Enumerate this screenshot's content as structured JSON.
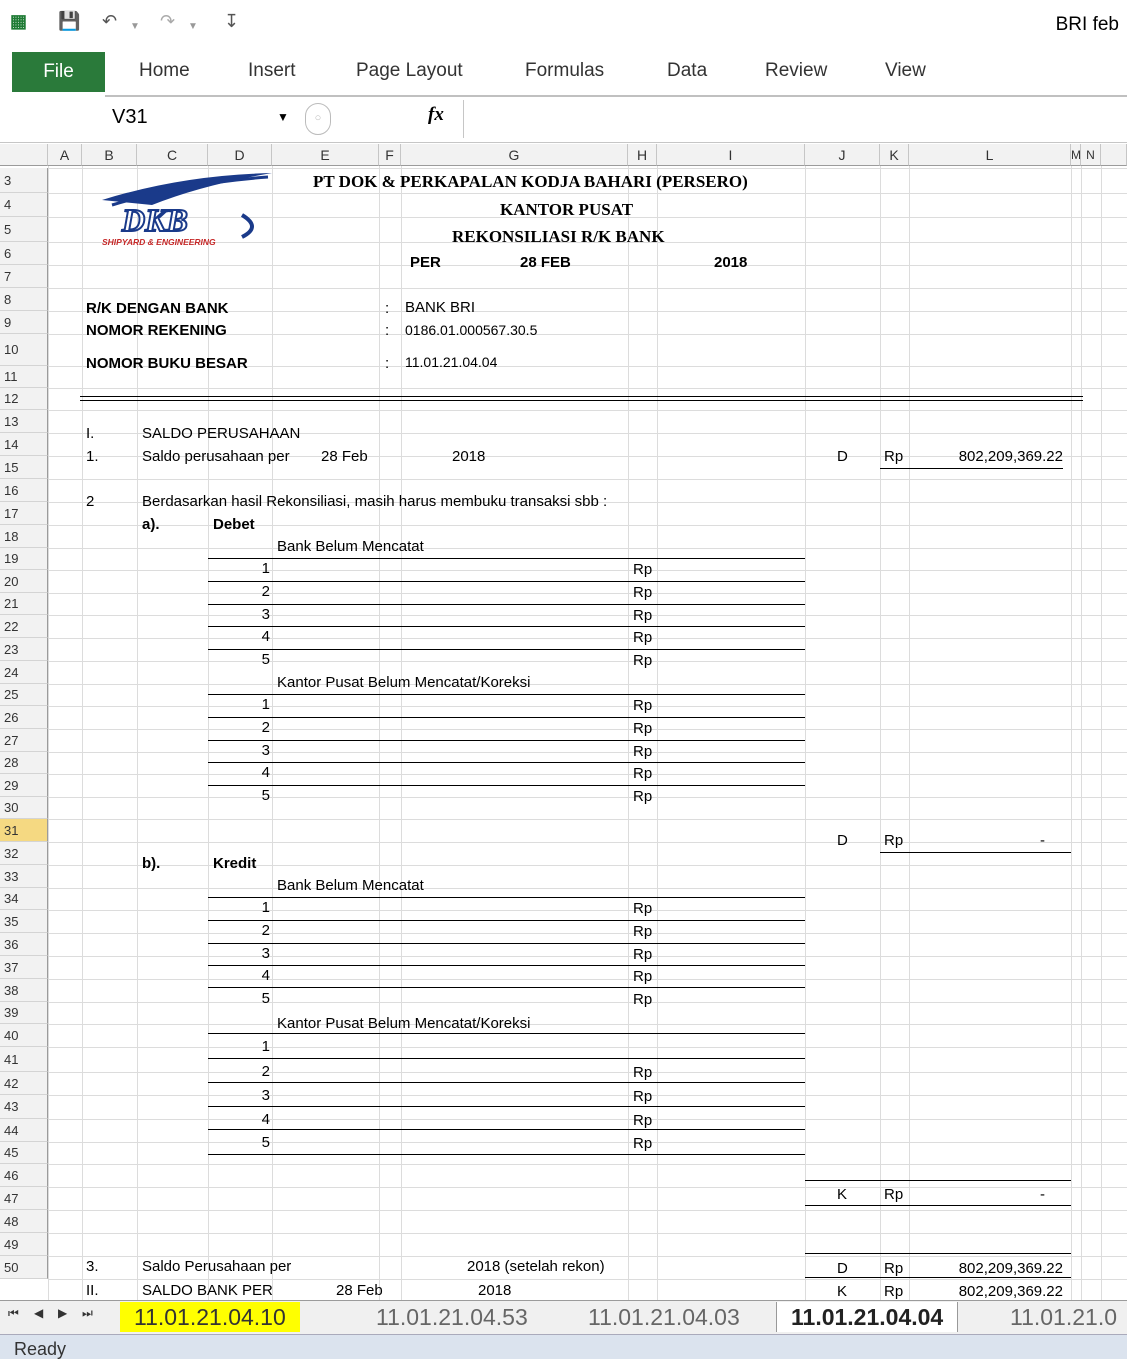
{
  "window": {
    "title": "BRI feb"
  },
  "ribbon": {
    "tabs": [
      "File",
      "Home",
      "Insert",
      "Page Layout",
      "Formulas",
      "Data",
      "Review",
      "View"
    ]
  },
  "formula_bar": {
    "name_box": "V31",
    "fx_label": "fx",
    "formula": ""
  },
  "columns": [
    "A",
    "B",
    "C",
    "D",
    "E",
    "F",
    "G",
    "H",
    "I",
    "J",
    "K",
    "L",
    "M",
    "N"
  ],
  "rows": [
    "3",
    "4",
    "5",
    "6",
    "7",
    "8",
    "9",
    "10",
    "11",
    "12",
    "13",
    "14",
    "15",
    "16",
    "17",
    "18",
    "19",
    "20",
    "21",
    "22",
    "23",
    "24",
    "25",
    "26",
    "27",
    "28",
    "29",
    "30",
    "31",
    "32",
    "33",
    "34",
    "35",
    "36",
    "37",
    "38",
    "39",
    "40",
    "41",
    "42",
    "43",
    "44",
    "45",
    "46",
    "47",
    "48",
    "49",
    "50"
  ],
  "selected_row": "31",
  "logo": {
    "text": "DKB",
    "tagline": "SHIPYARD & ENGINEERING"
  },
  "header": {
    "company": "PT DOK & PERKAPALAN KODJA BAHARI (PERSERO)",
    "office": "KANTOR PUSAT",
    "title": "REKONSILIASI R/K BANK",
    "per_label": "PER",
    "per_date": "28 FEB",
    "per_year": "2018"
  },
  "info": {
    "bank_label": "R/K DENGAN BANK",
    "bank_value": "BANK BRI",
    "acct_label": "NOMOR REKENING",
    "acct_value": "0186.01.000567.30.5",
    "ledger_label": "NOMOR BUKU BESAR",
    "ledger_value": "11.01.21.04.04",
    "colon": ":"
  },
  "section1": {
    "num": "I.",
    "title": "SALDO PERUSAHAAN",
    "item_num": "1.",
    "item_text": "Saldo perusahaan per",
    "item_date": "28 Feb",
    "item_year": "2018",
    "dk": "D",
    "rp": "Rp",
    "amount": "802,209,369.22"
  },
  "section2": {
    "num": "2",
    "text": "Berdasarkan hasil Rekonsiliasi, masih harus membuku transaksi sbb :",
    "debet_label": "a).",
    "debet_title": "Debet",
    "kredit_label": "b).",
    "kredit_title": "Kredit",
    "bank_belum": "Bank Belum Mencatat",
    "kp_belum": "Kantor Pusat Belum Mencatat/Koreksi",
    "item_nums": [
      "1",
      "2",
      "3",
      "4",
      "5"
    ],
    "rp": "Rp",
    "subtotal_debet": {
      "dk": "D",
      "rp": "Rp",
      "amount": "-"
    },
    "subtotal_kredit": {
      "dk": "K",
      "rp": "Rp",
      "amount": "-"
    }
  },
  "section3": {
    "num": "3.",
    "text": "Saldo Perusahaan per",
    "year": "2018 (setelah rekon)",
    "dk": "D",
    "rp": "Rp",
    "amount": "802,209,369.22"
  },
  "section4": {
    "num": "II.",
    "text": "SALDO BANK PER",
    "date": "28 Feb",
    "year": "2018",
    "dk": "K",
    "rp": "Rp",
    "amount": "802,209,369.22"
  },
  "sheet_tabs": [
    "11.01.21.04.10",
    "11.01.21.04.53",
    "11.01.21.04.03",
    "11.01.21.04.04",
    "11.01.21.0"
  ],
  "active_sheet": "11.01.21.04.04",
  "status": {
    "text": "Ready"
  },
  "colors": {
    "file_tab": "#2a7a3a",
    "highlight_tab": "#ffff00",
    "selected_row": "#f5d982",
    "logo_blue": "#1a3a8a"
  }
}
